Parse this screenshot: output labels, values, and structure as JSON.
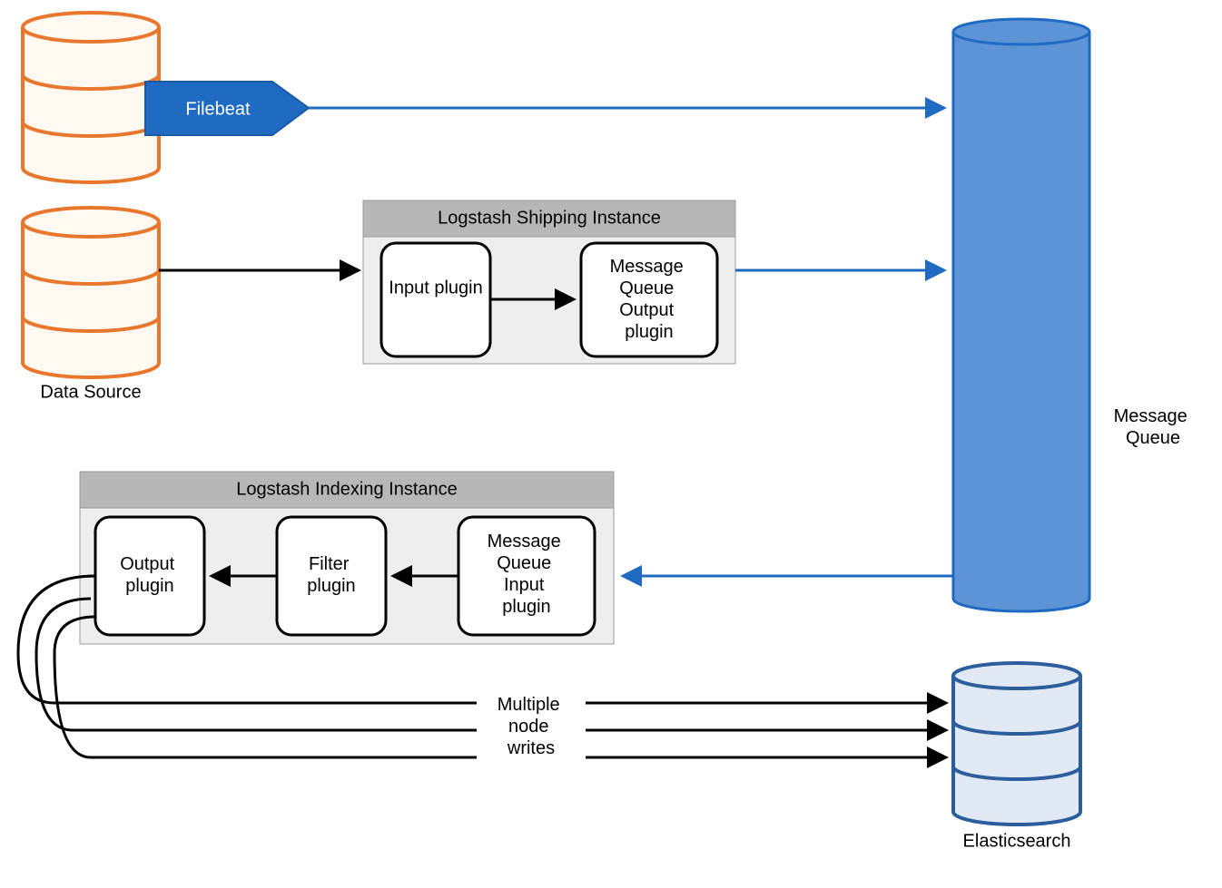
{
  "filebeat_label": "Filebeat",
  "data_source_label": "Data Source",
  "shipping_instance": {
    "title": "Logstash Shipping Instance",
    "input_plugin": "Input plugin",
    "mq_output_plugin_l1": "Message",
    "mq_output_plugin_l2": "Queue",
    "mq_output_plugin_l3": "Output",
    "mq_output_plugin_l4": "plugin"
  },
  "indexing_instance": {
    "title": "Logstash Indexing Instance",
    "output_plugin": "Output plugin",
    "filter_plugin": "Filter plugin",
    "mq_input_plugin_l1": "Message",
    "mq_input_plugin_l2": "Queue",
    "mq_input_plugin_l3": "Input",
    "mq_input_plugin_l4": "plugin"
  },
  "message_queue_l1": "Message",
  "message_queue_l2": "Queue",
  "multi_writes_l1": "Multiple",
  "multi_writes_l2": "node",
  "multi_writes_l3": "writes",
  "elasticsearch_label": "Elasticsearch"
}
